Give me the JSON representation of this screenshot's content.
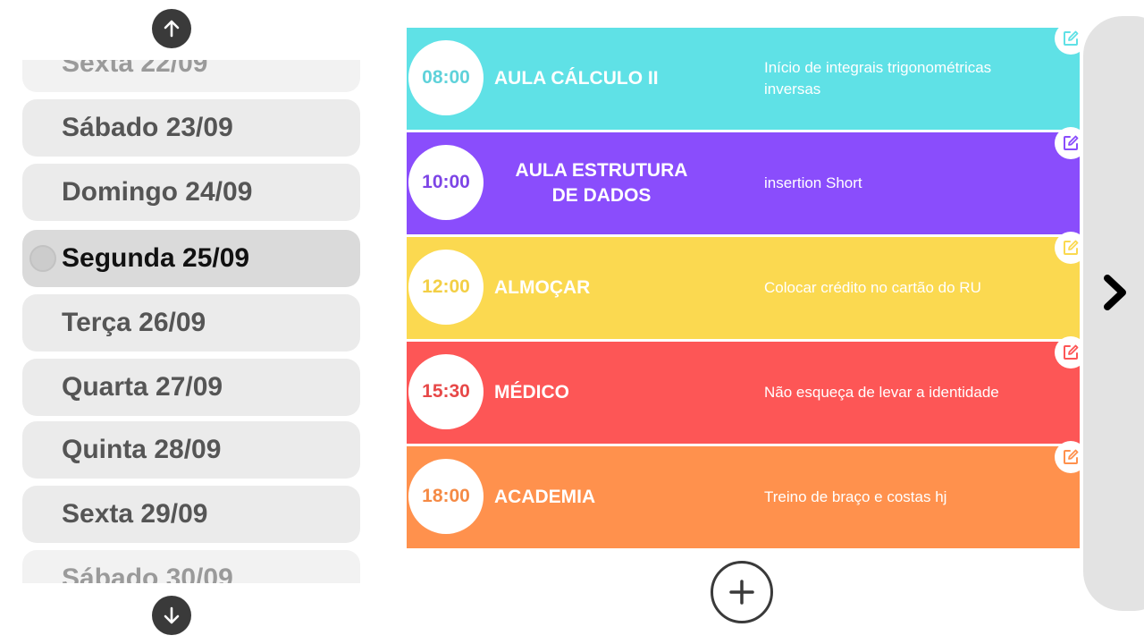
{
  "days": [
    {
      "label": "Sexta 22/09",
      "state": "faded"
    },
    {
      "label": "Sábado 23/09",
      "state": "normal"
    },
    {
      "label": "Domingo 24/09",
      "state": "normal"
    },
    {
      "label": "Segunda 25/09",
      "state": "selected"
    },
    {
      "label": "Terça 26/09",
      "state": "normal"
    },
    {
      "label": "Quarta 27/09",
      "state": "normal"
    },
    {
      "label": "Quinta 28/09",
      "state": "normal"
    },
    {
      "label": "Sexta 29/09",
      "state": "normal"
    },
    {
      "label": "Sábado 30/09",
      "state": "faded"
    }
  ],
  "events": [
    {
      "time": "08:00",
      "title_lines": [
        "AULA CÁLCULO II"
      ],
      "description": "Início de integrais trigonométricas inversas",
      "color": "#5fe1e6",
      "time_color": "#5fd2da"
    },
    {
      "time": "10:00",
      "title_lines": [
        "AULA ESTRUTURA",
        "DE DADOS"
      ],
      "description": "insertion Short",
      "color": "#8a4dfc",
      "time_color": "#7d45e6"
    },
    {
      "time": "12:00",
      "title_lines": [
        "ALMOÇAR"
      ],
      "description": "Colocar crédito no cartão do RU",
      "color": "#fbd950",
      "time_color": "#f3cf45"
    },
    {
      "time": "15:30",
      "title_lines": [
        "MÉDICO"
      ],
      "description": "Não esqueça de levar a identidade",
      "color": "#fd5656",
      "time_color": "#e74848"
    },
    {
      "time": "18:00",
      "title_lines": [
        "ACADEMIA"
      ],
      "description": "Treino de braço e costas hj",
      "color": "#ff914d",
      "time_color": "#f58a45"
    }
  ],
  "icons": {
    "scroll_up": "arrow-up-icon",
    "scroll_down": "arrow-down-icon",
    "edit": "edit-icon",
    "add": "plus-icon",
    "next": "chevron-right-icon"
  }
}
